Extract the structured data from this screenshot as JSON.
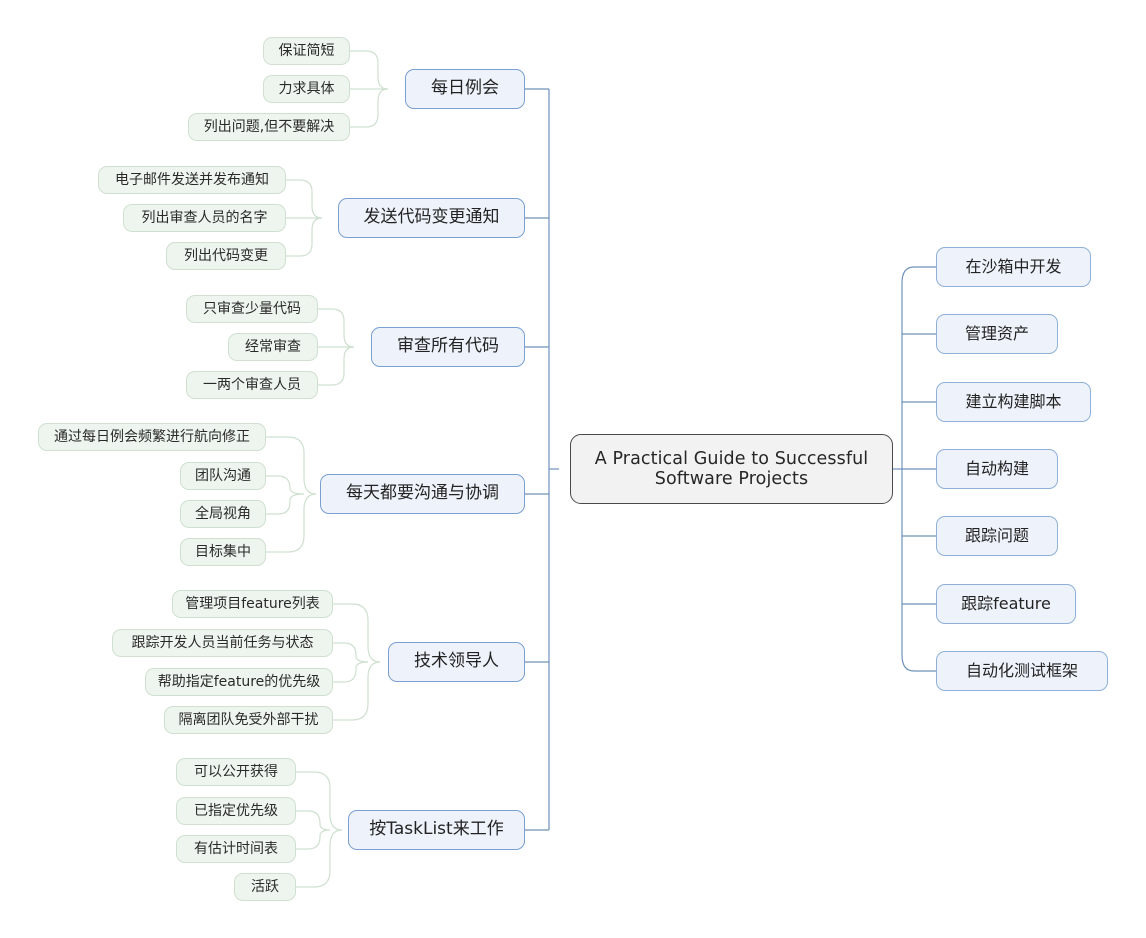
{
  "diagram": {
    "type": "mindmap",
    "title": "A Practical Guide to Successful Software Projects",
    "root": {
      "line1": "A Practical Guide to Successful",
      "line2": "Software Projects"
    },
    "colors": {
      "root_fill": "#f2f2f2",
      "root_border": "#4a4a4a",
      "main_fill": "#eef3fb",
      "main_border": "#7a9fd0",
      "leaf_fill": "#eef5ee",
      "leaf_border": "#cfe0d0",
      "spine_line": "#6f92bb",
      "leaf_line": "#cfe0d0",
      "text": "#262626"
    },
    "left_branches": [
      {
        "label": "每日例会",
        "children": [
          "保证简短",
          "力求具体",
          "列出问题,但不要解决"
        ]
      },
      {
        "label": "发送代码变更通知",
        "children": [
          "电子邮件发送并发布通知",
          "列出审查人员的名字",
          "列出代码变更"
        ]
      },
      {
        "label": "审查所有代码",
        "children": [
          "只审查少量代码",
          "经常审查",
          "一两个审查人员"
        ]
      },
      {
        "label": "每天都要沟通与协调",
        "children": [
          "通过每日例会频繁进行航向修正",
          "团队沟通",
          "全局视角",
          "目标集中"
        ]
      },
      {
        "label": "技术领导人",
        "children": [
          "管理项目feature列表",
          "跟踪开发人员当前任务与状态",
          "帮助指定feature的优先级",
          "隔离团队免受外部干扰"
        ]
      },
      {
        "label": "按TaskList来工作",
        "children": [
          "可以公开获得",
          "已指定优先级",
          "有估计时间表",
          "活跃"
        ]
      }
    ],
    "right_branches": [
      {
        "label": "在沙箱中开发"
      },
      {
        "label": "管理资产"
      },
      {
        "label": "建立构建脚本"
      },
      {
        "label": "自动构建"
      },
      {
        "label": "跟踪问题"
      },
      {
        "label": "跟踪feature"
      },
      {
        "label": "自动化测试框架"
      }
    ]
  }
}
